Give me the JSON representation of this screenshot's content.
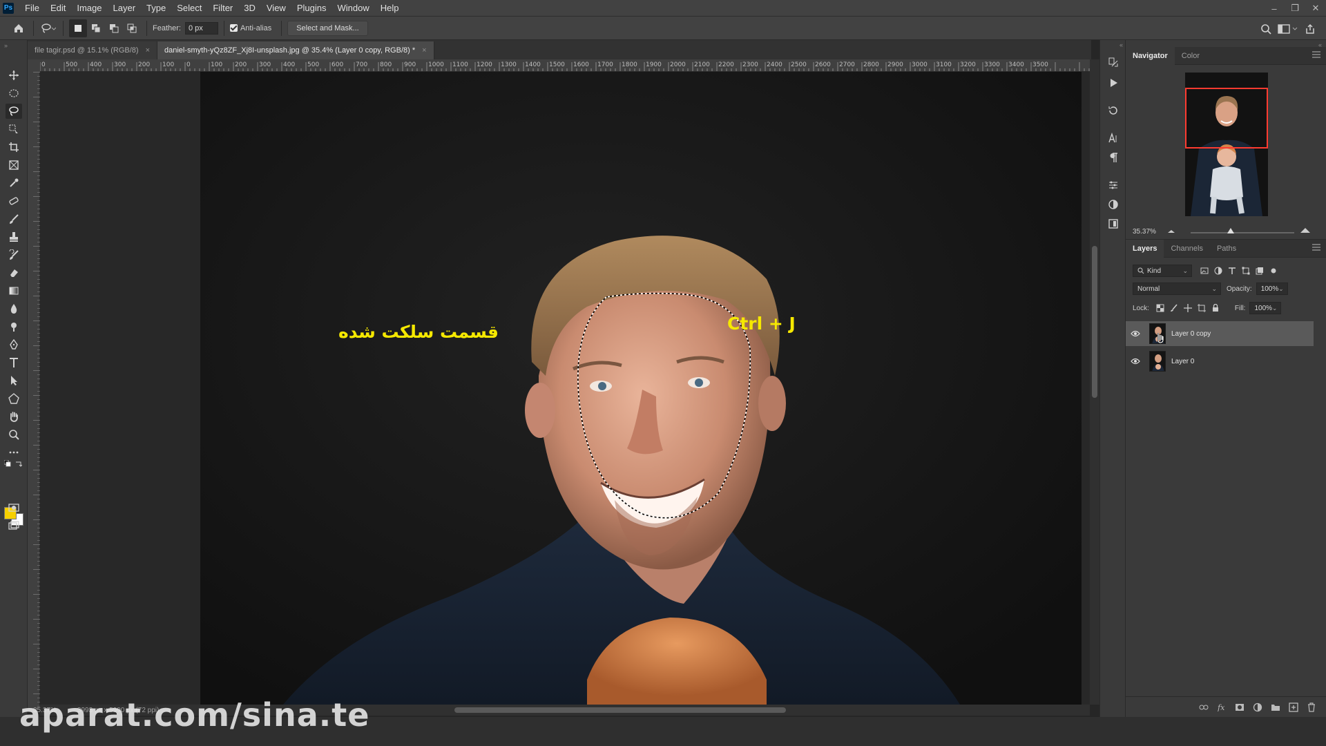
{
  "app": {
    "logo_text": "Ps",
    "menu": [
      "File",
      "Edit",
      "Image",
      "Layer",
      "Type",
      "Select",
      "Filter",
      "3D",
      "View",
      "Plugins",
      "Window",
      "Help"
    ]
  },
  "options_bar": {
    "feather_label": "Feather:",
    "feather_value": "0 px",
    "anti_alias_label": "Anti-alias",
    "select_mask_label": "Select and Mask..."
  },
  "tabs": [
    {
      "label": "file tagir.psd @ 15.1% (RGB/8)",
      "close": "×"
    },
    {
      "label": "daniel-smyth-yQz8ZF_Xj8I-unsplash.jpg @ 35.4% (Layer 0 copy, RGB/8) *",
      "close": "×"
    }
  ],
  "ruler_top": [
    "0",
    "500",
    "400",
    "300",
    "200",
    "100",
    "0",
    "100",
    "200",
    "300",
    "400",
    "500",
    "600",
    "700",
    "800",
    "900",
    "1000",
    "1100",
    "1200",
    "1300",
    "1400",
    "1500",
    "1600",
    "1700",
    "1800",
    "1900",
    "2000",
    "2100",
    "2200",
    "2300",
    "2400",
    "2500",
    "2600",
    "2700",
    "2800",
    "2900",
    "3000",
    "3100",
    "3200",
    "3300",
    "3400",
    "3500"
  ],
  "canvas": {
    "caption_selection": "قسمت سلکت شده",
    "caption_shortcut": "Ctrl + J"
  },
  "navigator": {
    "tabs": [
      "Navigator",
      "Color"
    ],
    "zoom": "35.37%"
  },
  "layers_panel": {
    "tabs": [
      "Layers",
      "Channels",
      "Paths"
    ],
    "filter_kind": "Kind",
    "blend_mode": "Normal",
    "opacity_label": "Opacity:",
    "opacity_value": "100%",
    "lock_label": "Lock:",
    "fill_label": "Fill:",
    "fill_value": "100%",
    "layers": [
      {
        "name": "Layer 0 copy",
        "selected": true
      },
      {
        "name": "Layer 0",
        "selected": false
      }
    ]
  },
  "status": {
    "zoom": "35.37%",
    "doc_size": "3993 px x 5990 px (72 ppi)"
  },
  "watermark": "aparat.com/sina.te",
  "colors": {
    "foreground": "#f7d000",
    "background": "#ffffff",
    "caption": "#f5e800",
    "nav_viewbox": "#ff3b30"
  }
}
